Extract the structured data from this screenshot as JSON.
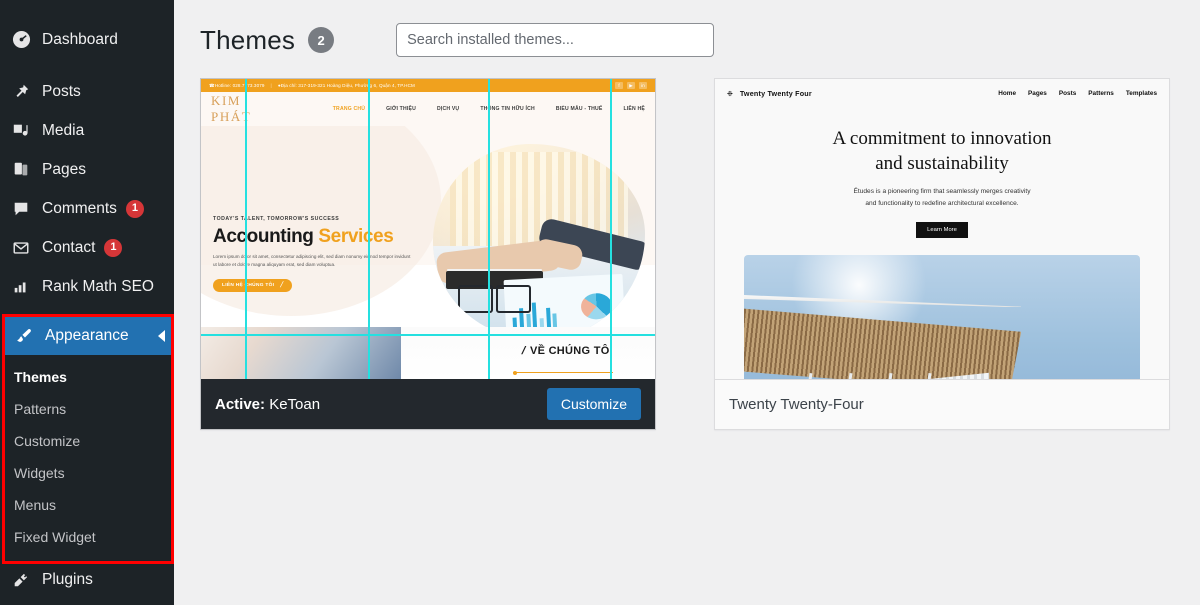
{
  "sidebar": {
    "items": [
      {
        "label": "Dashboard",
        "icon": "dashboard-icon",
        "badge": null
      },
      {
        "label": "Posts",
        "icon": "pin-icon",
        "badge": null
      },
      {
        "label": "Media",
        "icon": "media-icon",
        "badge": null
      },
      {
        "label": "Pages",
        "icon": "pages-icon",
        "badge": null
      },
      {
        "label": "Comments",
        "icon": "comment-icon",
        "badge": "1"
      },
      {
        "label": "Contact",
        "icon": "envelope-icon",
        "badge": "1"
      },
      {
        "label": "Rank Math SEO",
        "icon": "seo-icon",
        "badge": null
      }
    ],
    "appearance": {
      "label": "Appearance",
      "icon": "paintbrush-icon",
      "submenu": [
        {
          "label": "Themes",
          "current": true
        },
        {
          "label": "Patterns",
          "current": false
        },
        {
          "label": "Customize",
          "current": false
        },
        {
          "label": "Widgets",
          "current": false
        },
        {
          "label": "Menus",
          "current": false
        },
        {
          "label": "Fixed Widget",
          "current": false
        }
      ]
    },
    "plugins": {
      "label": "Plugins",
      "icon": "plug-icon"
    },
    "colors": {
      "background": "#1d2327",
      "active": "#2271b1",
      "badge": "#d63638",
      "highlight_border": "#ff0000"
    }
  },
  "header": {
    "title": "Themes",
    "count": "2",
    "search_placeholder": "Search installed themes...",
    "search_value": ""
  },
  "themes": [
    {
      "name": "KeToan",
      "status_label": "Active:",
      "is_active": true,
      "button_label": "Customize",
      "button_color": "#2271b1",
      "preview": {
        "topbar": {
          "hotline": "Hotline: 028.7773.3079",
          "address": "Địa chỉ: 317-319-321 Hoàng Diệu, Phường 6, Quận 4, TP.HCM",
          "socials": [
            "f",
            "▶",
            "in"
          ]
        },
        "logo": "KIM PHÁT",
        "menu": [
          "TRANG CHỦ",
          "GIỚI THIỆU",
          "DỊCH VỤ",
          "THÔNG TIN HỮU ÍCH",
          "BIỂU MẪU - THUẾ",
          "LIÊN HỆ"
        ],
        "kicker": "TODAY'S TALENT, TOMORROW'S SUCCESS",
        "title_part1": "Accounting",
        "title_part2": "Services",
        "description": "Lorem ipsum dolor sit amet, consectetur adipiscing elit, sed diam nonumy eirmod tempor invidunt ut labore et dolore magna aliquyam erat, sed diam voluptua.",
        "cta": "LIÊN HỆ CHÚNG TÔI",
        "about_heading": "VỀ CHÚNG TÔI",
        "accent": "#f0a11e",
        "guides_color": "#25e0e0"
      }
    },
    {
      "name": "Twenty Twenty-Four",
      "status_label": "",
      "is_active": false,
      "button_label": "",
      "preview": {
        "brand": "Twenty Twenty Four",
        "menu": [
          "Home",
          "Pages",
          "Posts",
          "Patterns",
          "Templates"
        ],
        "headline_line1": "A commitment to innovation",
        "headline_line2": "and sustainability",
        "subtext_line1": "Études is a pioneering firm that seamlessly merges creativity",
        "subtext_line2": "and functionality to redefine architectural excellence.",
        "cta": "Learn More"
      }
    }
  ]
}
